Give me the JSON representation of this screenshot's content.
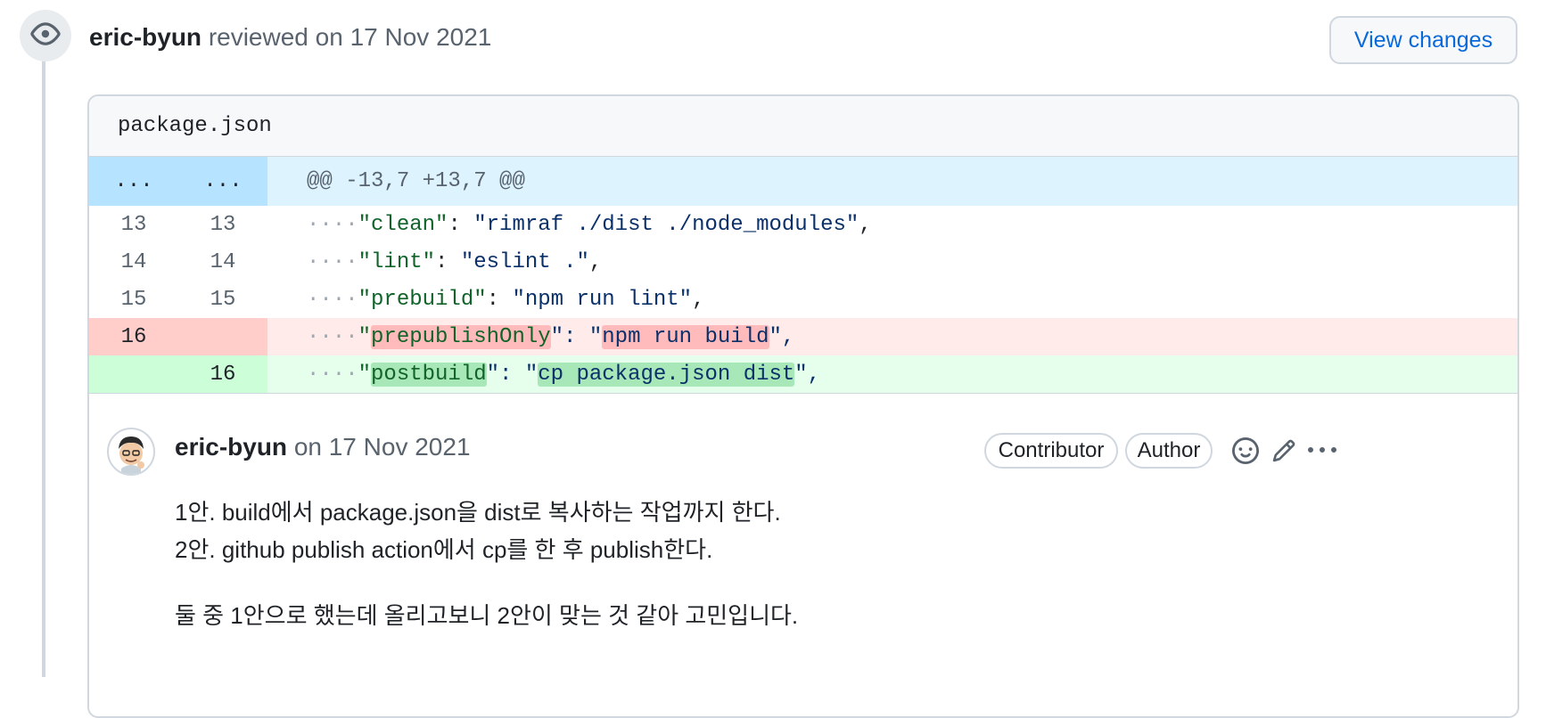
{
  "review": {
    "author": "eric-byun",
    "action_text": "reviewed on 17 Nov 2021",
    "view_changes_label": "View changes",
    "event_icon": "eye-icon"
  },
  "file": {
    "name": "package.json"
  },
  "diff": {
    "hunk": {
      "old": "...",
      "new": "...",
      "text": "@@ -13,7 +13,7 @@"
    },
    "lines": [
      {
        "type": "context",
        "old": "13",
        "new": "13",
        "indent": "····",
        "key": "\"clean\"",
        "sep": ": ",
        "value": "\"rimraf ./dist ./node_modules\"",
        "tail": ","
      },
      {
        "type": "context",
        "old": "14",
        "new": "14",
        "indent": "····",
        "key": "\"lint\"",
        "sep": ": ",
        "value": "\"eslint .\"",
        "tail": ","
      },
      {
        "type": "context",
        "old": "15",
        "new": "15",
        "indent": "····",
        "key": "\"prebuild\"",
        "sep": ": ",
        "value": "\"npm run lint\"",
        "tail": ","
      },
      {
        "type": "deletion",
        "old": "16",
        "new": "",
        "indent": "····",
        "q": "\"",
        "key_inner": "prepublishOnly",
        "mid": "\": \"",
        "value_inner": "npm run build",
        "tail": "\","
      },
      {
        "type": "addition",
        "old": "",
        "new": "16",
        "indent": "····",
        "q": "\"",
        "key_inner": "postbuild",
        "mid": "\": \"",
        "value_inner": "cp package.json dist",
        "tail": "\","
      }
    ]
  },
  "comment": {
    "author": "eric-byun",
    "date_text": "on 17 Nov 2021",
    "badges": [
      "Contributor",
      "Author"
    ],
    "icons": [
      "smiley-icon",
      "pencil-icon",
      "kebab-horizontal-icon"
    ],
    "lines": [
      "1안. build에서 package.json을 dist로 복사하는 작업까지 한다.",
      "2안. github publish action에서 cp를 한 후 publish한다.",
      "둘 중 1안으로 했는데 올리고보니 2안이 맞는 것 같아 고민입니다."
    ]
  }
}
